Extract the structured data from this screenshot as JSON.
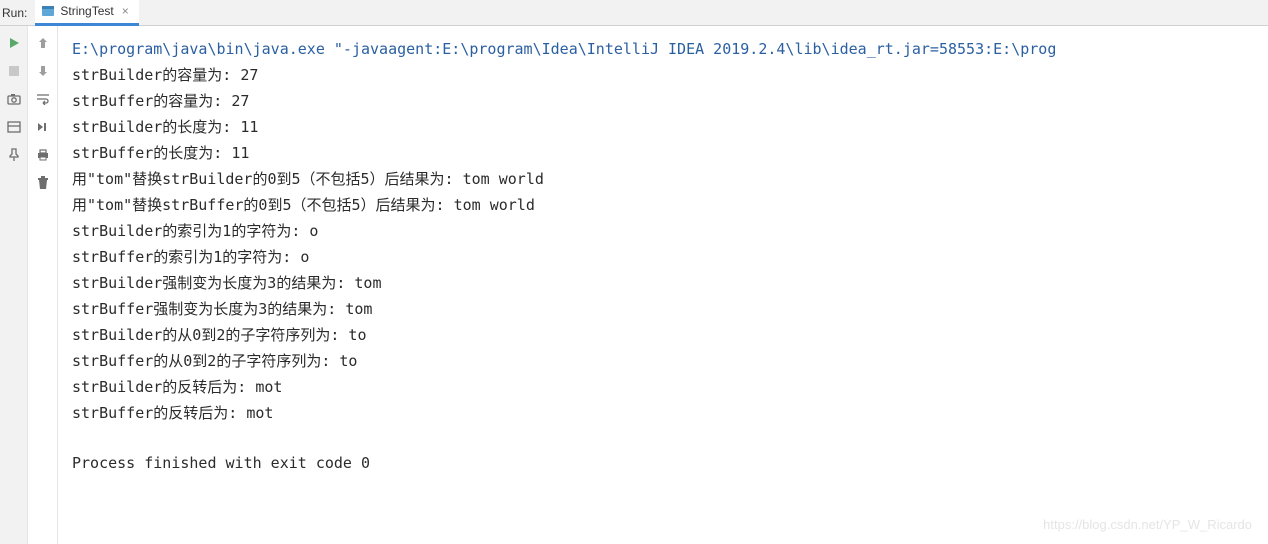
{
  "header": {
    "run_label": "Run:",
    "tab_label": "StringTest",
    "close_glyph": "×"
  },
  "console": {
    "command": "E:\\program\\java\\bin\\java.exe \"-javaagent:E:\\program\\Idea\\IntelliJ IDEA 2019.2.4\\lib\\idea_rt.jar=58553:E:\\prog",
    "lines": [
      "strBuilder的容量为: 27",
      "strBuffer的容量为: 27",
      "strBuilder的长度为: 11",
      "strBuffer的长度为: 11",
      "用\"tom\"替换strBuilder的0到5（不包括5）后结果为: tom world",
      "用\"tom\"替换strBuffer的0到5（不包括5）后结果为: tom world",
      "strBuilder的索引为1的字符为: o",
      "strBuffer的索引为1的字符为: o",
      "strBuilder强制变为长度为3的结果为: tom",
      "strBuffer强制变为长度为3的结果为: tom",
      "strBuilder的从0到2的子字符序列为: to",
      "strBuffer的从0到2的子字符序列为: to",
      "strBuilder的反转后为: mot",
      "strBuffer的反转后为: mot"
    ],
    "finished": "Process finished with exit code 0"
  },
  "watermark": "https://blog.csdn.net/YP_W_Ricardo"
}
